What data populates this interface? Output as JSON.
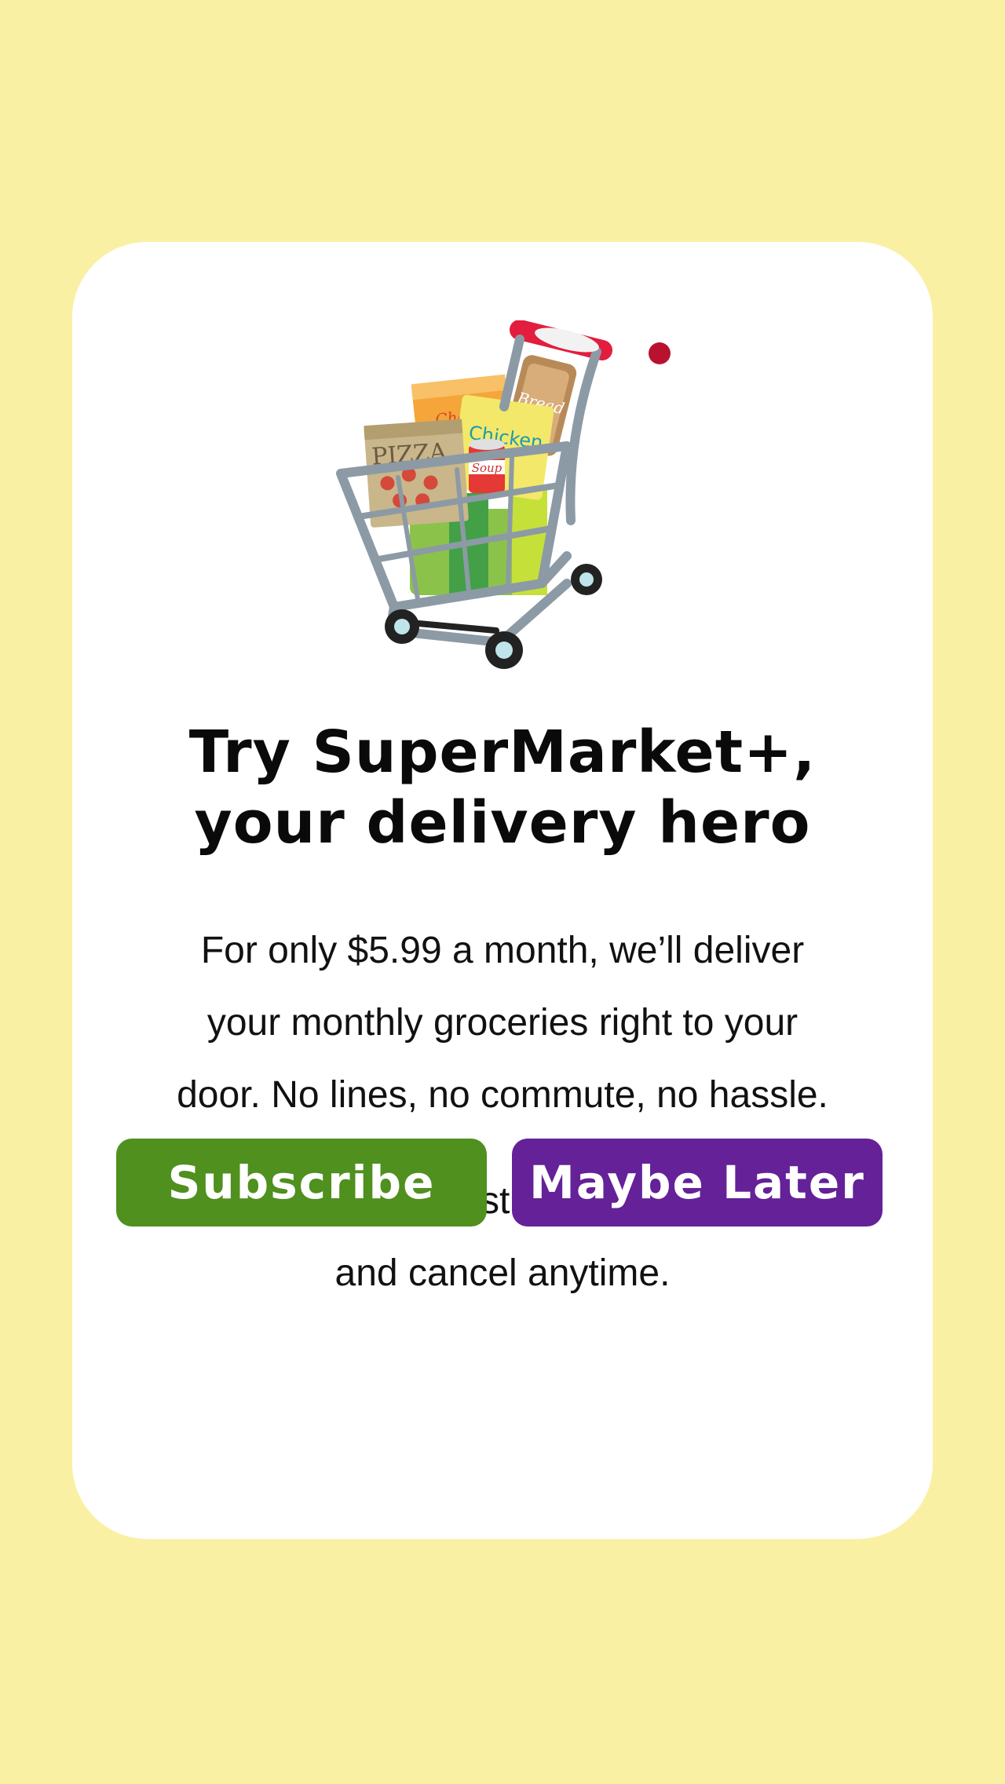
{
  "promo": {
    "title_line1": "Try SuperMarket+,",
    "title_line2": "your delivery hero",
    "body_line1": "For only $5.99 a month, we’ll deliver",
    "body_line2": "your monthly groceries right to your",
    "body_line3": "door. No lines, no commute, no hassle.",
    "offer_line1": "Get your first month free,",
    "offer_line2": "and cancel anytime.",
    "illustration_icon": "shopping-cart-icon",
    "cart_labels": {
      "pizza": "PIZZA",
      "cheese": "Cheese",
      "bread": "Bread",
      "chicken": "Chicken",
      "soup": "Soup"
    }
  },
  "actions": {
    "subscribe_label": "Subscribe",
    "later_label": "Maybe Later"
  },
  "colors": {
    "background": "#f9f0a3",
    "card": "#ffffff",
    "subscribe": "#4f901e",
    "later": "#642198"
  }
}
